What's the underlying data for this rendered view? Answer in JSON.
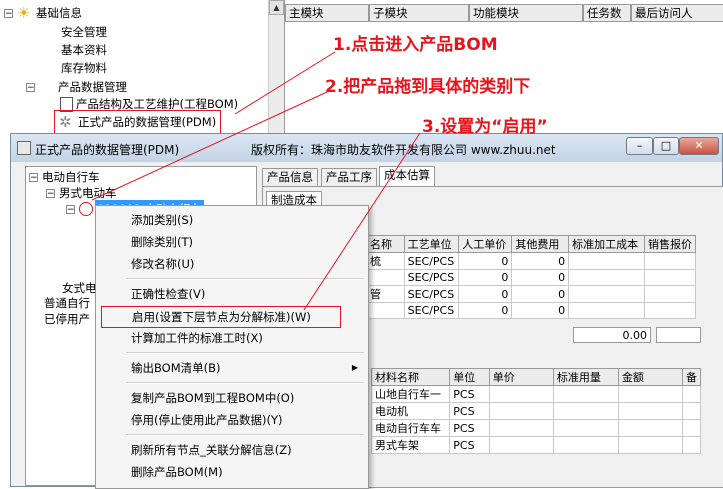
{
  "background_tree": {
    "root": "基础信息",
    "items": [
      "安全管理",
      "基本资料",
      "库存物料"
    ],
    "folder": "产品数据管理",
    "subitems": [
      "产品结构及工艺维护(工程BOM)",
      "正式产品的数据管理(PDM)"
    ]
  },
  "background_grid": {
    "headers": [
      "主模块",
      "子模块",
      "功能模块",
      "任务数",
      "最后访问人"
    ]
  },
  "window": {
    "title": "正式产品的数据管理(PDM)",
    "copyright": "版权所有：珠海市助友软件开发有限公司 www.zhuu.net",
    "minimize": "–",
    "maximize": "□",
    "close": "✕"
  },
  "left_tree": {
    "root": "电动自行车",
    "child": "男式电动车",
    "selected": "010001 电动自行车",
    "female": "女式电",
    "normal": "普通自行",
    "disabled": "已停用产"
  },
  "tabs": [
    "产品信息",
    "产品工序",
    "成本估算"
  ],
  "subtab": "制造成本",
  "process_table": {
    "headers": [
      "名称",
      "工艺单位",
      "人工单价",
      "其他费用",
      "标准加工成本",
      "销售报价"
    ],
    "rows": [
      {
        "name": "梳",
        "unit": "SEC/PCS",
        "labor": "0",
        "other": "0"
      },
      {
        "name": "",
        "unit": "SEC/PCS",
        "labor": "0",
        "other": "0"
      },
      {
        "name": "管",
        "unit": "SEC/PCS",
        "labor": "0",
        "other": "0"
      },
      {
        "name": "",
        "unit": "SEC/PCS",
        "labor": "0",
        "other": "0"
      }
    ],
    "total": "0.00"
  },
  "material_table": {
    "headers": [
      "材料名称",
      "单位",
      "单价",
      "标准用量",
      "金额",
      "备"
    ],
    "rows": [
      {
        "name": "山地自行车一",
        "unit": "PCS"
      },
      {
        "name": "电动机",
        "unit": "PCS"
      },
      {
        "name": "电动自行车车",
        "unit": "PCS"
      },
      {
        "name": "男式车架",
        "unit": "PCS"
      }
    ]
  },
  "context_menu": {
    "items": [
      "添加类别(S)",
      "删除类别(T)",
      "修改名称(U)",
      "正确性检查(V)",
      "启用(设置下层节点为分解标准)(W)",
      "计算加工件的标准工时(X)",
      "输出BOM清单(B)",
      "复制产品BOM到工程BOM中(O)",
      "停用(停止使用此产品数据)(Y)",
      "刷新所有节点_关联分解信息(Z)",
      "删除产品BOM(M)"
    ],
    "submenu_arrow": "▶"
  },
  "annotations": {
    "step1": "1.点击进入产品BOM",
    "step2": "2.把产品拖到具体的类别下",
    "step3": "3.设置为“启用”"
  },
  "colors": {
    "annotation": "#e8141c",
    "selection": "#3399ff"
  }
}
